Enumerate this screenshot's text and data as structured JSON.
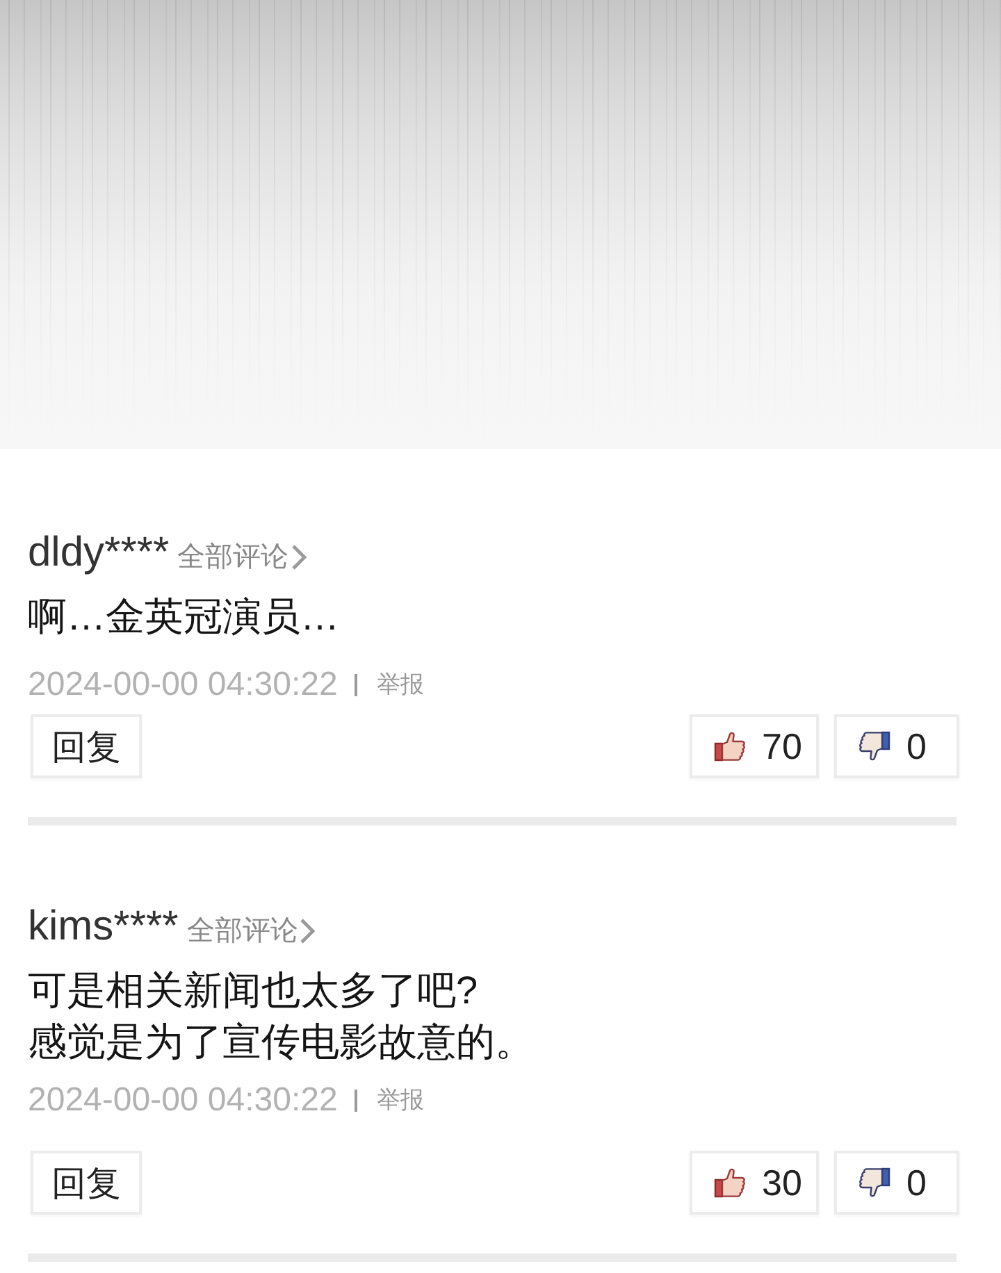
{
  "comments": [
    {
      "username": "dldy****",
      "all_comments_link": "全部评论",
      "text": "啊…金英冠演员…",
      "timestamp": "2024-00-00 04:30:22",
      "report": "举报",
      "reply": "回复",
      "likes": "70",
      "dislikes": "0"
    },
    {
      "username": "kims****",
      "all_comments_link": "全部评论",
      "text": "可是相关新闻也太多了吧?\n感觉是为了宣传电影故意的。",
      "timestamp": "2024-00-00 04:30:22",
      "report": "举报",
      "reply": "回复",
      "likes": "30",
      "dislikes": "0"
    }
  ]
}
